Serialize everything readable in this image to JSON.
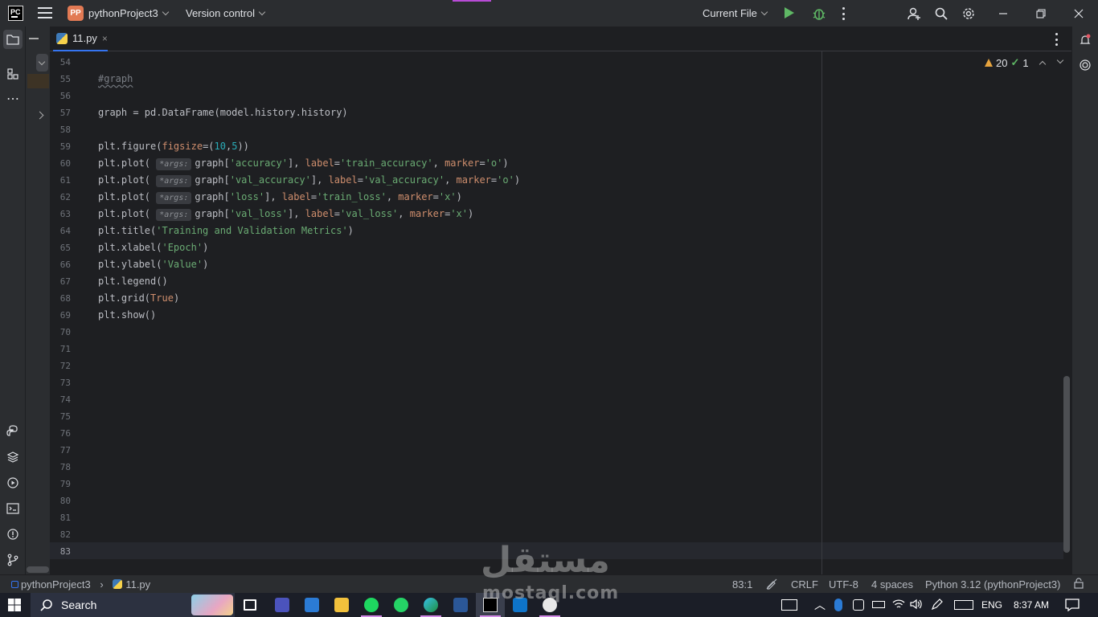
{
  "titlebar": {
    "logo": "PC",
    "project_badge": "PP",
    "project_name": "pythonProject3",
    "version_control": "Version control",
    "run_config": "Current File"
  },
  "tab": {
    "label": "11.py",
    "close": "×"
  },
  "inspections": {
    "warnings": "20",
    "ok": "1"
  },
  "editor": {
    "line_numbers": [
      "54",
      "55",
      "56",
      "57",
      "58",
      "59",
      "60",
      "61",
      "62",
      "63",
      "64",
      "65",
      "66",
      "67",
      "68",
      "69",
      "70",
      "71",
      "72",
      "73",
      "74",
      "75",
      "76",
      "77",
      "78",
      "79",
      "80",
      "81",
      "82",
      "83"
    ],
    "current_line": "83",
    "hint_label": "*args:",
    "code": {
      "comment": "#graph",
      "l57": "graph = pd.DataFrame(model.history.history)",
      "l59_a": "plt.figure(",
      "l59_p": "figsize",
      "l59_b": "=(",
      "l59_n1": "10",
      "l59_c": ",",
      "l59_n2": "5",
      "l59_d": "))",
      "l60_a": "plt.plot( ",
      "l60_b": "graph[",
      "l60_s1": "'accuracy'",
      "l60_c": "], ",
      "l60_p1": "label",
      "l60_s2": "'train_accuracy'",
      "l60_p2": "marker",
      "l60_s3": "'o'",
      "l61_s1": "'val_accuracy'",
      "l61_s2": "'val_accuracy'",
      "l61_s3": "'o'",
      "l62_s1": "'loss'",
      "l62_s2": "'train_loss'",
      "l62_s3": "'x'",
      "l63_s1": "'val_loss'",
      "l63_s2": "'val_loss'",
      "l63_s3": "'x'",
      "l64_a": "plt.title(",
      "l64_s": "'Training and Validation Metrics'",
      "l65_a": "plt.xlabel(",
      "l65_s": "'Epoch'",
      "l66_a": "plt.ylabel(",
      "l66_s": "'Value'",
      "l67": "plt.legend()",
      "l68_a": "plt.grid(",
      "l68_k": "True",
      "l69": "plt.show()"
    }
  },
  "statusbar": {
    "breadcrumb_project": "pythonProject3",
    "breadcrumb_file": "11.py",
    "position": "83:1",
    "line_sep": "CRLF",
    "encoding": "UTF-8",
    "indent": "4 spaces",
    "interpreter": "Python 3.12 (pythonProject3)"
  },
  "taskbar": {
    "search": "Search",
    "lang": "ENG",
    "time": "8:37 AM"
  },
  "watermark": {
    "arabic": "مستقل",
    "latin": "mostaql.com"
  },
  "colors": {
    "accent": "#3574f0",
    "string": "#6aab73",
    "number": "#2aacb8",
    "keyword": "#cf8e6d",
    "warning": "#e6a33e",
    "run": "#5fb865"
  }
}
